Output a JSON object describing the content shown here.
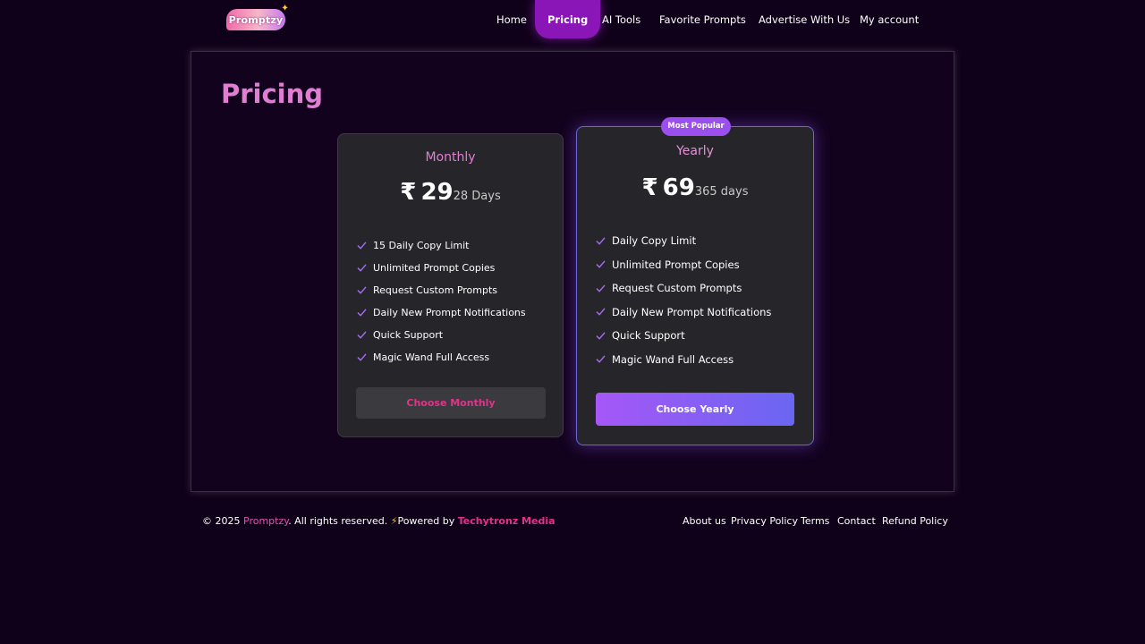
{
  "header": {
    "logo_text": "Promptzy",
    "nav": [
      {
        "label": "Home",
        "active": false
      },
      {
        "label": "Pricing",
        "active": true
      },
      {
        "label": "AI Tools",
        "active": false
      },
      {
        "label": "Favorite Prompts",
        "active": false
      },
      {
        "label": "Advertise With Us",
        "active": false
      },
      {
        "label": "My account",
        "active": false
      }
    ]
  },
  "main": {
    "title": "Pricing",
    "plans": [
      {
        "name": "Monthly",
        "currency": "₹",
        "amount": "29",
        "period": "28 Days",
        "features": [
          "15 Daily Copy Limit",
          "Unlimited Prompt Copies",
          "Request Custom Prompts",
          "Daily New Prompt Notifications",
          "Quick Support",
          "Magic Wand Full Access"
        ],
        "button_label": "Choose Monthly"
      },
      {
        "name": "Yearly",
        "badge": "Most Popular",
        "currency": "₹",
        "amount": "69",
        "period": "365 days",
        "features": [
          "Daily Copy Limit",
          "Unlimited Prompt Copies",
          "Request Custom Prompts",
          "Daily New Prompt Notifications",
          "Quick Support",
          "Magic Wand Full Access"
        ],
        "button_label": "Choose Yearly"
      }
    ]
  },
  "footer": {
    "copyright_prefix": "© 2025 ",
    "brand": "Promptzy",
    "rights": ". All rights reserved. ",
    "bolt": "⚡",
    "powered_by": "Powered by ",
    "company": "Techytronz Media",
    "links": [
      "About us",
      "Privacy Policy",
      "Terms",
      "Contact",
      "Refund Policy"
    ]
  },
  "colors": {
    "background": "#10011a",
    "accent_pink": "#e07ed4",
    "nav_active": "#8a16b8",
    "yearly_border": "#6f63d8",
    "button_gradient_start": "#a657f6",
    "button_gradient_end": "#6a66f2",
    "check_color": "#a56cf0"
  },
  "icons": {
    "feature_bullet": "check-icon"
  }
}
